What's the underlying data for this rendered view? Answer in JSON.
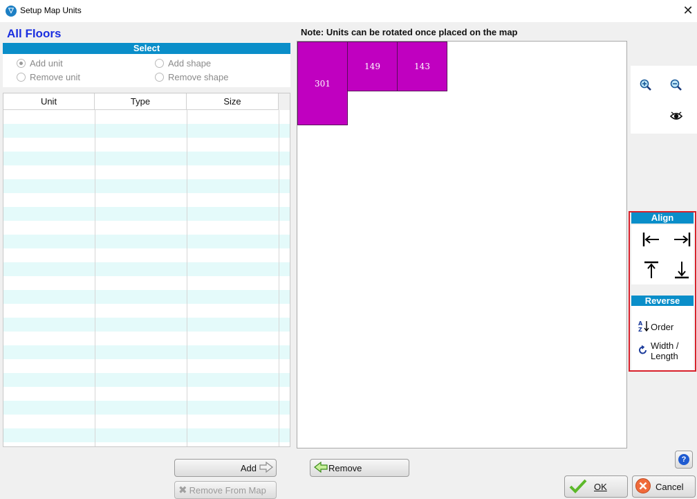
{
  "window": {
    "title": "Setup Map Units",
    "close_glyph": "✕"
  },
  "floors_label": "All Floors",
  "select": {
    "header": "Select",
    "options": [
      {
        "label": "Add unit",
        "selected": true
      },
      {
        "label": "Remove unit",
        "selected": false
      },
      {
        "label": "Add shape",
        "selected": false
      },
      {
        "label": "Remove shape",
        "selected": false
      }
    ]
  },
  "table": {
    "columns": [
      "Unit",
      "Type",
      "Size"
    ],
    "rows": []
  },
  "note": "Note: Units can be rotated once placed on the map",
  "map": {
    "unit_color": "#c000c0",
    "units": [
      {
        "label": "301"
      },
      {
        "label": "149"
      },
      {
        "label": "143"
      }
    ]
  },
  "zoom": {
    "icons": [
      "zoom-in-icon",
      "zoom-out-icon",
      "eye-icon"
    ]
  },
  "align": {
    "header": "Align",
    "buttons": [
      "align-left-icon",
      "align-right-icon",
      "align-top-icon",
      "align-bottom-icon"
    ]
  },
  "reverse": {
    "header": "Reverse",
    "order_label": "Order",
    "width_length_label_1": "Width /",
    "width_length_label_2": "Length"
  },
  "buttons": {
    "add": "Add",
    "remove_from_map": "Remove From Map",
    "remove": "Remove",
    "ok": "OK",
    "cancel": "Cancel",
    "help": "?"
  },
  "colors": {
    "header_blue": "#0a8ec9",
    "title_blue": "#1a2ee0",
    "highlight_red": "#d8202a"
  }
}
